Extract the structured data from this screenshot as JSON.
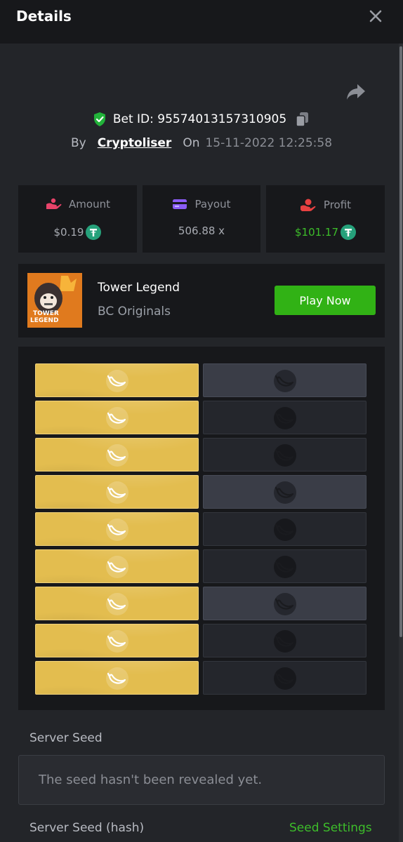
{
  "header": {
    "title": "Details"
  },
  "bet": {
    "id_text": "Bet ID: 95574013157310905",
    "by_label": "By",
    "user": "Cryptoliser",
    "on_label": "On",
    "date": "15-11-2022 12:25:58"
  },
  "stats": [
    {
      "label": "Amount",
      "value": "$0.19",
      "icon": "amount-icon",
      "value_color": "#a8abb2",
      "icon_color": "#e8436a"
    },
    {
      "label": "Payout",
      "value": "506.88 x",
      "icon": "payout-icon",
      "value_color": "#a8abb2",
      "icon_color": "#8b5cf6"
    },
    {
      "label": "Profit",
      "value": "$101.17",
      "icon": "profit-icon",
      "value_color": "#3dbd2a",
      "icon_color": "#e84141"
    }
  ],
  "game": {
    "title": "Tower Legend",
    "provider": "BC Originals",
    "play_label": "Play Now",
    "thumb_text": "TOWER LEGEND"
  },
  "board": {
    "rows": [
      {
        "gold_side": "left",
        "dark_lit": true
      },
      {
        "gold_side": "left",
        "dark_lit": false
      },
      {
        "gold_side": "left",
        "dark_lit": false
      },
      {
        "gold_side": "left",
        "dark_lit": true
      },
      {
        "gold_side": "left",
        "dark_lit": false
      },
      {
        "gold_side": "left",
        "dark_lit": false
      },
      {
        "gold_side": "left",
        "dark_lit": true
      },
      {
        "gold_side": "left",
        "dark_lit": false
      },
      {
        "gold_side": "left",
        "dark_lit": false
      }
    ],
    "tile_icon": "banana-icon"
  },
  "seed": {
    "server_seed_label": "Server Seed",
    "server_seed_value": "The seed hasn't been revealed yet.",
    "hash_label": "Server Seed (hash)",
    "settings_label": "Seed Settings"
  },
  "colors": {
    "accent_green": "#31b215",
    "gold_tile": "#e3bd4f",
    "tether": "#26a17b"
  }
}
